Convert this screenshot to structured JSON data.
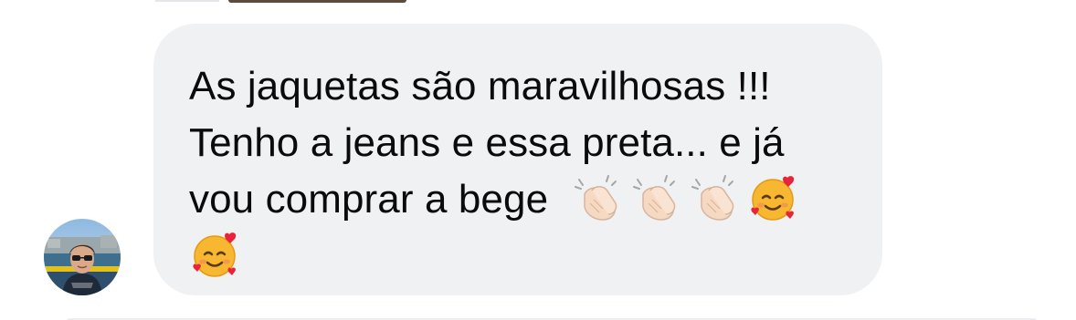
{
  "message": {
    "text_line1": "As jaquetas são maravilhosas !!!",
    "text_line2": "Tenho a jeans e essa preta... e já",
    "text_line3": "vou comprar a bege",
    "emojis": [
      {
        "name": "clapping-hands-emoji",
        "char": "👏🏻"
      },
      {
        "name": "clapping-hands-emoji",
        "char": "👏🏻"
      },
      {
        "name": "clapping-hands-emoji",
        "char": "👏🏻"
      },
      {
        "name": "smiling-face-with-hearts-emoji",
        "char": "🥰"
      },
      {
        "name": "smiling-face-with-hearts-emoji",
        "char": "🥰"
      }
    ]
  },
  "colors": {
    "bubble_background": "#f0f1f3",
    "text": "#0b0b0c",
    "page_background": "#ffffff"
  }
}
